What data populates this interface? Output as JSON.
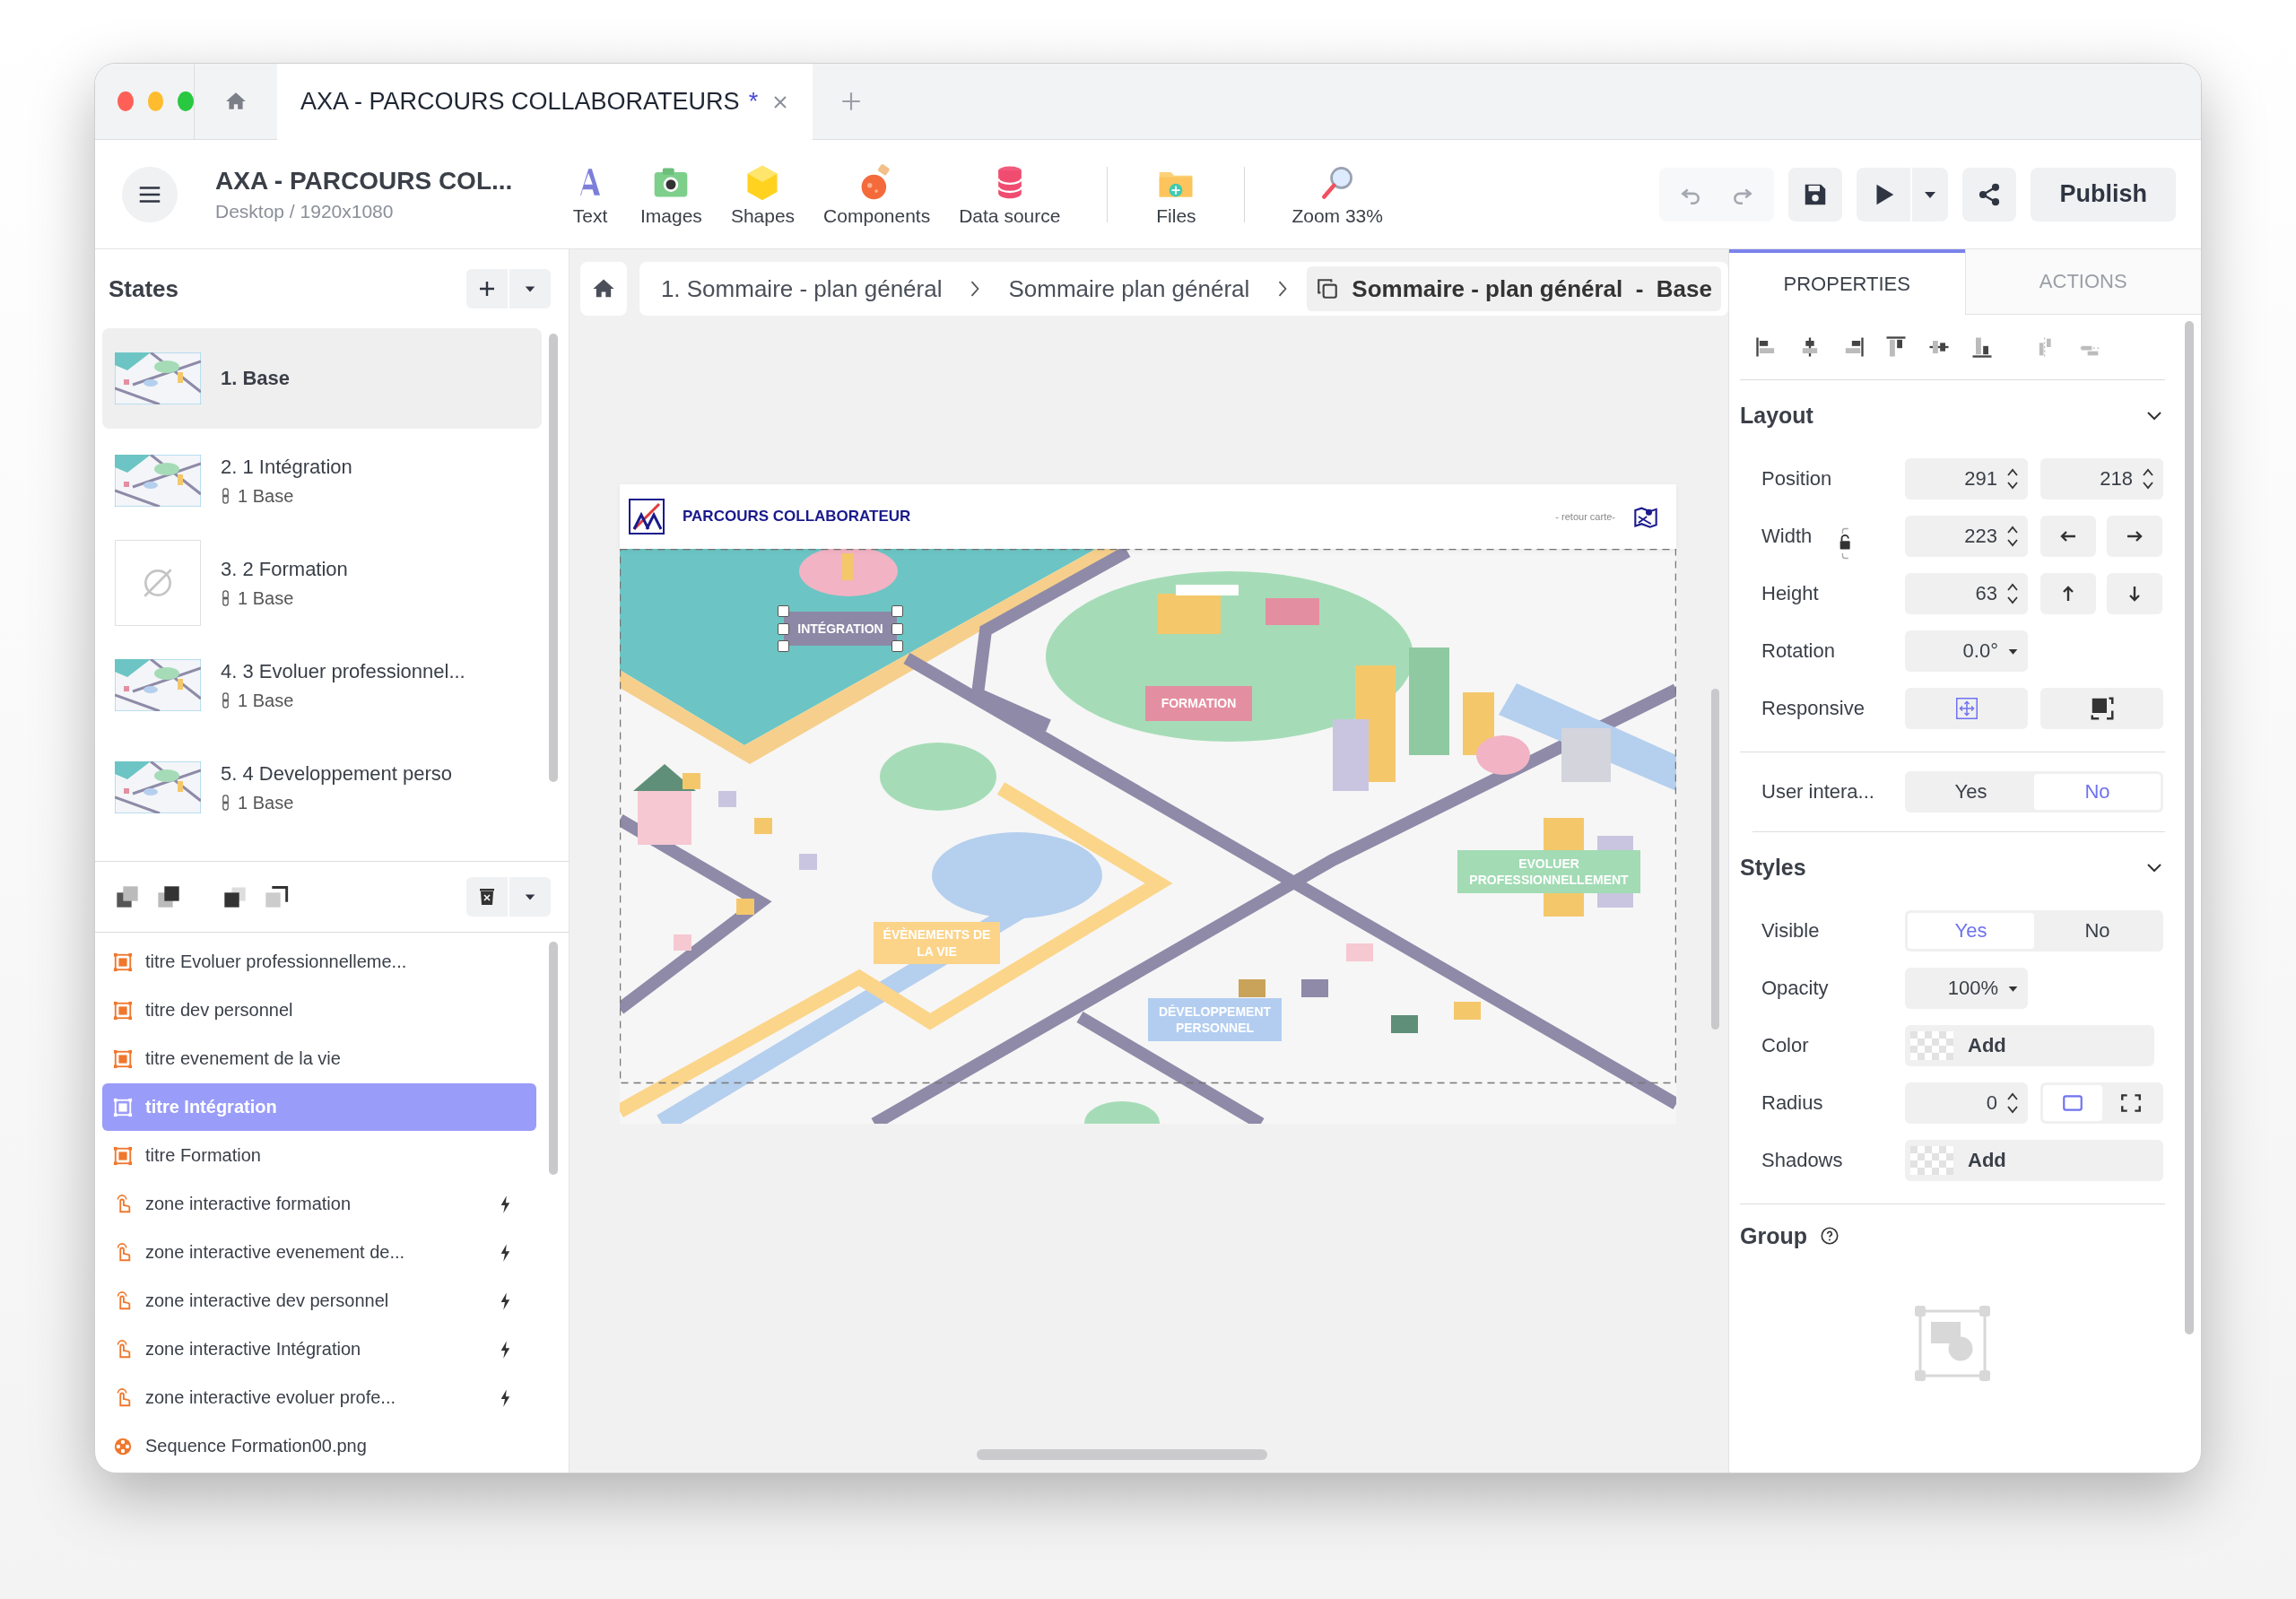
{
  "tabs": [
    {
      "title": "AXA - PARCOURS COLLABORATEURS",
      "unsaved_mark": "*",
      "selected": true
    }
  ],
  "project": {
    "title": "AXA - PARCOURS COL...",
    "subtitle": "Desktop / 1920x1080"
  },
  "tool_groups": [
    [
      {
        "kind": "text",
        "label": "Text"
      },
      {
        "kind": "images",
        "label": "Images"
      },
      {
        "kind": "shapes",
        "label": "Shapes"
      },
      {
        "kind": "components",
        "label": "Components"
      },
      {
        "kind": "datasource",
        "label": "Data source"
      }
    ],
    [
      {
        "kind": "files",
        "label": "Files"
      }
    ],
    [
      {
        "kind": "zoom",
        "label": "Zoom 33%"
      }
    ]
  ],
  "publish_label": "Publish",
  "states": {
    "title": "States",
    "items": [
      {
        "label": "1. Base",
        "kind": "thumbnail",
        "selected": true
      },
      {
        "label": "2. 1 Intégration",
        "base": "1 Base",
        "kind": "thumbnail",
        "selected": false
      },
      {
        "label": "3. 2 Formation",
        "base": "1 Base",
        "kind": "empty",
        "selected": false
      },
      {
        "label": "4. 3 Evoluer professionnel...",
        "base": "1 Base",
        "kind": "thumbnail",
        "selected": false
      },
      {
        "label": "5. 4 Developpement perso",
        "base": "1 Base",
        "kind": "thumbnail",
        "selected": false
      }
    ]
  },
  "layers": [
    {
      "label": "titre Evoluer professionnelleme...",
      "kind": "image",
      "has_action": false,
      "selected": false
    },
    {
      "label": "titre dev personnel",
      "kind": "image",
      "has_action": false,
      "selected": false
    },
    {
      "label": "titre evenement de la vie",
      "kind": "image",
      "has_action": false,
      "selected": false
    },
    {
      "label": "titre Intégration",
      "kind": "image",
      "has_action": false,
      "selected": true
    },
    {
      "label": "titre Formation",
      "kind": "image",
      "has_action": false,
      "selected": false
    },
    {
      "label": "zone interactive formation",
      "kind": "hotspot",
      "has_action": true,
      "selected": false
    },
    {
      "label": "zone interactive evenement de...",
      "kind": "hotspot",
      "has_action": true,
      "selected": false
    },
    {
      "label": "zone interactive dev personnel",
      "kind": "hotspot",
      "has_action": true,
      "selected": false
    },
    {
      "label": "zone interactive Intégration",
      "kind": "hotspot",
      "has_action": true,
      "selected": false
    },
    {
      "label": "zone interactive evoluer profe...",
      "kind": "hotspot",
      "has_action": true,
      "selected": false
    },
    {
      "label": "Sequence Formation00.png",
      "kind": "sequence",
      "has_action": false,
      "selected": false
    }
  ],
  "breadcrumb": [
    {
      "label": "1. Sommaire - plan général",
      "selected": false
    },
    {
      "label": "Sommaire plan général",
      "selected": false
    },
    {
      "label": "Sommaire - plan général  -  Base",
      "selected": true
    }
  ],
  "canvas": {
    "header_title": "PARCOURS COLLABORATEUR",
    "back_link": "- retour carte-",
    "labels": [
      {
        "text": "INTÉGRATION",
        "color": "#8c88a6",
        "selected": true
      },
      {
        "text": "FORMATION",
        "color": "#e48fa1",
        "selected": false
      },
      {
        "text": "ÉVÈNEMENTS DE LA VIE",
        "color": "#fbd48a",
        "selected": false
      },
      {
        "text": "EVOLUER PROFESSIONNELLEMENT",
        "color": "#a2dbb4",
        "selected": false
      },
      {
        "text": "DÉVELOPPEMENT PERSONNEL",
        "color": "#b3cdf0",
        "selected": false
      }
    ]
  },
  "properties": {
    "tabs": [
      {
        "label": "PROPERTIES",
        "selected": true
      },
      {
        "label": "ACTIONS",
        "selected": false
      }
    ],
    "align_buttons": [
      {
        "kind": "left",
        "disabled": false
      },
      {
        "kind": "hcenter",
        "disabled": false
      },
      {
        "kind": "right",
        "disabled": false
      },
      {
        "kind": "top",
        "disabled": false
      },
      {
        "kind": "vcenter",
        "disabled": false
      },
      {
        "kind": "bottom",
        "disabled": false
      },
      {
        "kind": "hdist",
        "disabled": true
      },
      {
        "kind": "vdist",
        "disabled": true
      }
    ],
    "layout": {
      "title": "Layout",
      "expanded": true,
      "rows": [
        {
          "label": "Position",
          "kind": "pair",
          "values": [
            "291",
            "218"
          ]
        },
        {
          "label": "Width",
          "kind": "hsize",
          "value": "223"
        },
        {
          "label": "Height",
          "kind": "vsize",
          "value": "63"
        },
        {
          "label": "Rotation",
          "kind": "dropdown",
          "value": "0.0°"
        },
        {
          "label": "Responsive",
          "kind": "responsive"
        }
      ]
    },
    "interaction": {
      "label": "User intera...",
      "options": [
        {
          "label": "Yes",
          "selected": false
        },
        {
          "label": "No",
          "selected": true
        }
      ]
    },
    "styles": {
      "title": "Styles",
      "expanded": true,
      "rows": [
        {
          "label": "Visible",
          "kind": "toggle",
          "options": [
            {
              "label": "Yes",
              "selected": true
            },
            {
              "label": "No",
              "selected": false
            }
          ]
        },
        {
          "label": "Opacity",
          "kind": "dropdown",
          "value": "100%"
        },
        {
          "label": "Color",
          "kind": "swatch",
          "value": "Add"
        },
        {
          "label": "Radius",
          "kind": "radius",
          "value": "0"
        },
        {
          "label": "Shadows",
          "kind": "swatch",
          "value": "Add"
        }
      ]
    },
    "group": {
      "title": "Group"
    }
  }
}
